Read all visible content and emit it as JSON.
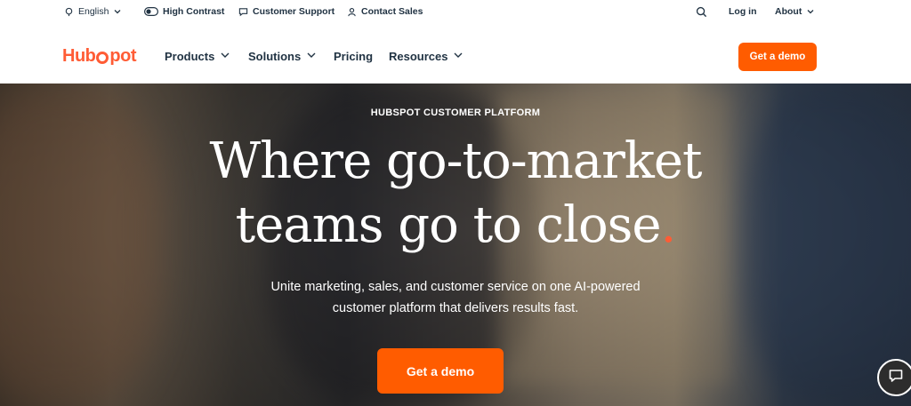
{
  "utility": {
    "language_label": "English",
    "contrast_label": "High Contrast",
    "support_label": "Customer Support",
    "sales_label": "Contact Sales",
    "login_label": "Log in",
    "about_label": "About"
  },
  "nav": {
    "logo_text_a": "Hub",
    "logo_text_b": "pot",
    "products_label": "Products",
    "solutions_label": "Solutions",
    "pricing_label": "Pricing",
    "resources_label": "Resources",
    "demo_label": "Get a demo"
  },
  "hero": {
    "eyebrow": "HUBSPOT CUSTOMER PLATFORM",
    "headline_line1": "Where go-to-market",
    "headline_line2": "teams go to close",
    "headline_dot": ".",
    "subtext_line1": "Unite marketing, sales, and customer service on one AI-powered",
    "subtext_line2": "customer platform that delivers results fast.",
    "cta_label": "Get a demo"
  },
  "colors": {
    "brand_orange": "#ff5c35",
    "button_orange": "#ff5c00",
    "nav_text": "#213343"
  },
  "icons": {
    "language": "globe-icon",
    "contrast": "toggle-icon",
    "support": "chat-icon",
    "sales": "person-icon",
    "search": "search-icon",
    "chat_widget": "chat-bubble-icon"
  }
}
